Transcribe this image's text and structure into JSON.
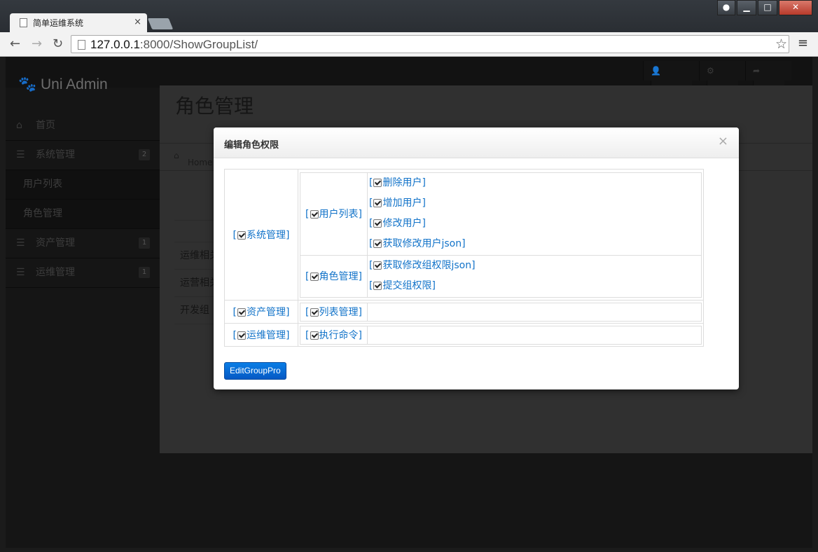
{
  "browser": {
    "tab_title": "简单运维系统",
    "tab_close": "×",
    "url_host": "127.0.0.1",
    "url_rest": ":8000/ShowGroupList/"
  },
  "app": {
    "brand": "Uni Admin",
    "topnav": {
      "admin": "admin",
      "settings": "设置",
      "logout": "退出"
    },
    "sidebar": {
      "home": "首页",
      "system": {
        "label": "系统管理",
        "badge": "2"
      },
      "user_list": "用户列表",
      "role_manage": "角色管理",
      "assets": {
        "label": "资产管理",
        "badge": "1"
      },
      "ops": {
        "label": "运维管理",
        "badge": "1"
      }
    },
    "page_title": "角色管理",
    "breadcrumb": "Home",
    "bg_rows": [
      "运维相关",
      "运营相关",
      "开发组"
    ]
  },
  "modal": {
    "title": "编辑角色权限",
    "close": "×",
    "groups": {
      "system": "系统管理",
      "user_list": "用户列表",
      "perm_delete_user": "删除用户",
      "perm_add_user": "增加用户",
      "perm_edit_user": "修改用户",
      "perm_get_edit_user": "获取修改用户json",
      "role_manage": "角色管理",
      "perm_get_edit_group": "获取修改组权限json",
      "perm_submit_group": "提交组权限",
      "assets": "资产管理",
      "list_manage": "列表管理",
      "ops": "运维管理",
      "exec_cmd": "执行命令"
    },
    "submit_label": "EditGroupPro"
  }
}
